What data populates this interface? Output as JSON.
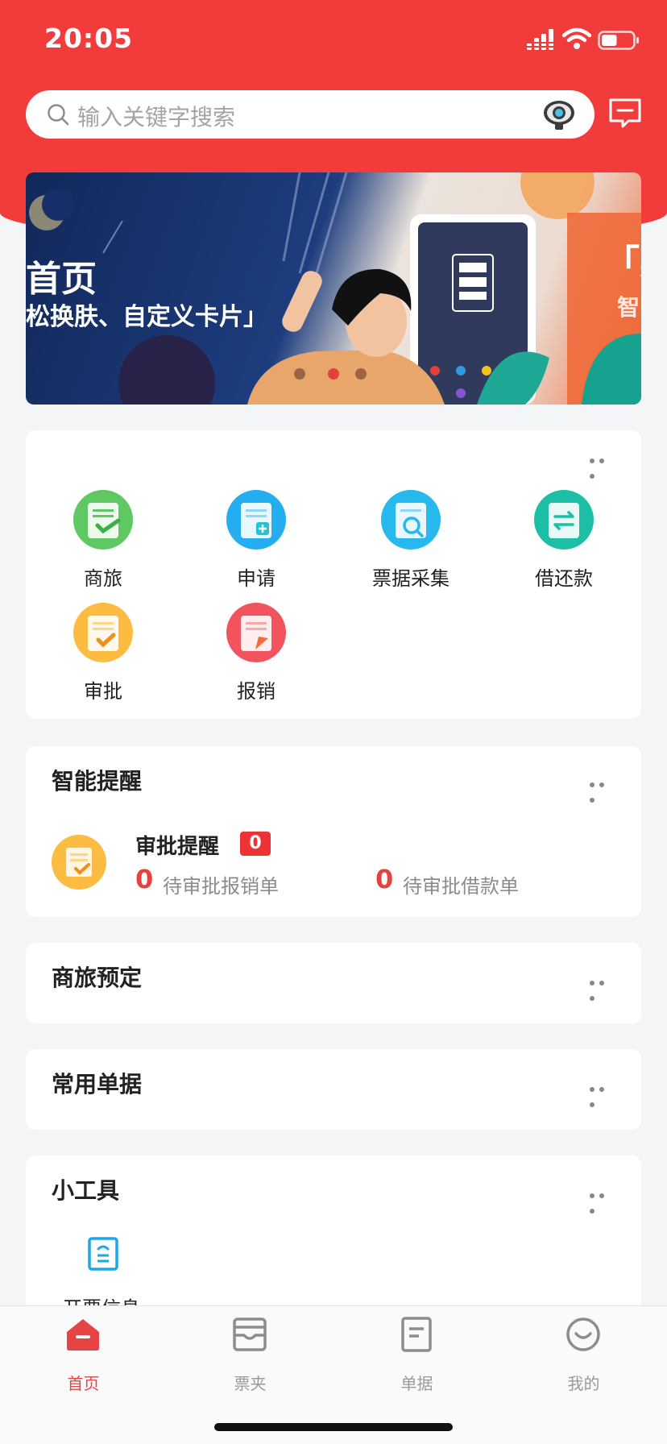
{
  "status_bar": {
    "time": "20:05",
    "battery_level": 0.5
  },
  "search": {
    "placeholder": "输入关键字搜索"
  },
  "banner": {
    "title_fragment": "首页",
    "subtitle_fragment": "松换肤、自定义卡片」",
    "right_title_fragment": "「票",
    "right_sub_fragment": "智"
  },
  "apps": {
    "items": [
      {
        "label": "商旅",
        "icon": "business-travel-icon",
        "color": "#5fc862"
      },
      {
        "label": "申请",
        "icon": "application-icon",
        "color": "#24aef0"
      },
      {
        "label": "票据采集",
        "icon": "invoice-collect-icon",
        "color": "#27b8ee"
      },
      {
        "label": "借还款",
        "icon": "loan-repay-icon",
        "color": "#1cbfa6"
      },
      {
        "label": "审批",
        "icon": "approval-icon",
        "color": "#fcbc41"
      },
      {
        "label": "报销",
        "icon": "reimburse-icon",
        "color": "#f1545d"
      }
    ]
  },
  "smart_reminder": {
    "title": "智能提醒",
    "item_title": "审批提醒",
    "badge": "0",
    "pending_reimburse_count": "0",
    "pending_reimburse_label": "待审批报销单",
    "pending_loan_count": "0",
    "pending_loan_label": "待审批借款单"
  },
  "travel_booking": {
    "title": "商旅预定"
  },
  "common_docs": {
    "title": "常用单据"
  },
  "tools": {
    "title": "小工具",
    "items": [
      {
        "label": "开票信息",
        "icon": "invoice-info-icon"
      }
    ]
  },
  "tabbar": {
    "items": [
      {
        "label": "首页",
        "icon": "home-icon",
        "active": true
      },
      {
        "label": "票夹",
        "icon": "ticket-folder-icon",
        "active": false
      },
      {
        "label": "单据",
        "icon": "document-icon",
        "active": false
      },
      {
        "label": "我的",
        "icon": "profile-icon",
        "active": false
      }
    ]
  },
  "colors": {
    "brand_red": "#f23b3b",
    "active_tab": "#e54444",
    "badge_red": "#ee3336"
  }
}
